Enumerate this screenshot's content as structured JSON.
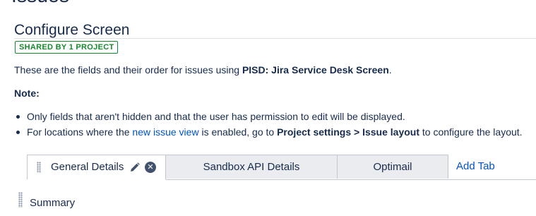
{
  "page": {
    "heading": "Issues"
  },
  "screen": {
    "title": "Configure Screen",
    "badge": "SHARED BY 1 PROJECT",
    "desc_prefix": "These are the fields and their order for issues using ",
    "screen_name": "PISD: Jira Service Desk Screen",
    "desc_suffix": "."
  },
  "note": {
    "label": "Note:",
    "bullet1": "Only fields that aren't hidden and that the user has permission to edit will be displayed.",
    "bullet2_prefix": "For locations where the ",
    "bullet2_link": "new issue view",
    "bullet2_mid": " is enabled, go to ",
    "bullet2_b1": "Project settings",
    "bullet2_sep": " > ",
    "bullet2_b2": "Issue layout",
    "bullet2_suffix": " to configure the layout."
  },
  "tabs": [
    {
      "label": "General Details",
      "active": true
    },
    {
      "label": "Sandbox API Details",
      "active": false
    },
    {
      "label": "Optimail",
      "active": false
    }
  ],
  "add_tab_label": "Add Tab",
  "fields": [
    {
      "label": "Summary"
    }
  ],
  "icons": [
    "drag-handle-icon",
    "pencil-icon",
    "remove-circle-icon"
  ],
  "colors": {
    "link": "#0052cc",
    "badge": "#14892c",
    "text": "#172b4d",
    "tab_inactive": "#ebecf0"
  }
}
